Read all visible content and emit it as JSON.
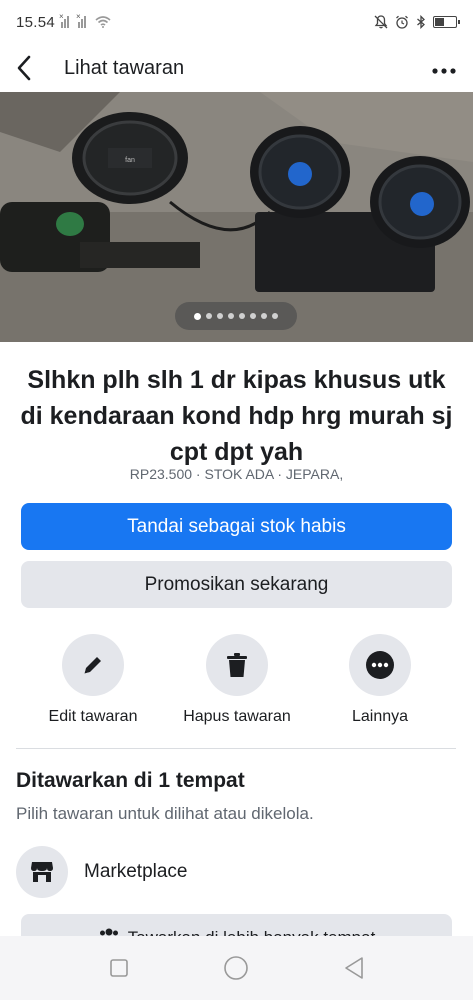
{
  "status_bar": {
    "time": "15.54"
  },
  "header": {
    "title": "Lihat tawaran"
  },
  "listing": {
    "title": "Slhkn plh slh 1 dr kipas khusus utk di kendaraan kond hdp hrg murah sj cpt dpt yah",
    "meta": "RP23.500 · STOK ADA · JEPARA,",
    "photo_count": 8,
    "active_photo_index": 0
  },
  "buttons": {
    "mark_sold": "Tandai sebagai stok habis",
    "promote": "Promosikan sekarang",
    "list_more": "Tawarkan di lebih banyak tempat"
  },
  "actions": [
    {
      "label": "Edit tawaran",
      "icon": "pencil-icon"
    },
    {
      "label": "Hapus tawaran",
      "icon": "trash-icon"
    },
    {
      "label": "Lainnya",
      "icon": "more-icon"
    }
  ],
  "places_section": {
    "title": "Ditawarkan di 1 tempat",
    "subtitle": "Pilih tawaran untuk dilihat atau dikelola.",
    "places": [
      {
        "label": "Marketplace",
        "icon": "storefront-icon"
      }
    ]
  },
  "colors": {
    "primary": "#1877f2",
    "secondary_bg": "#e4e6eb",
    "text": "#1c1e21",
    "muted": "#606770"
  }
}
